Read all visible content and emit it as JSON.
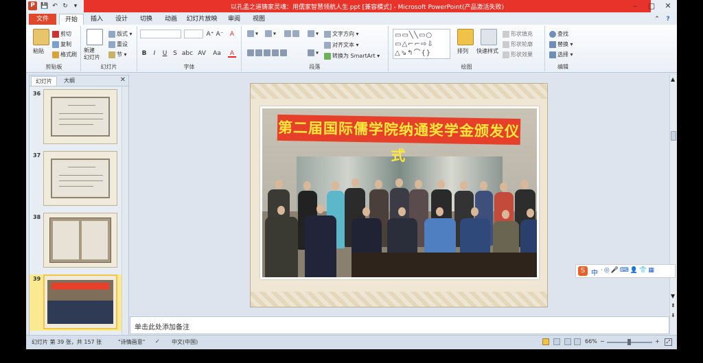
{
  "window": {
    "title": "以孔孟之道铸家灵魂：用儒家智慧领航人生.ppt [兼容模式] - Microsoft PowerPoint(产品激活失败)",
    "minimize": "–",
    "maximize": "▢",
    "close": "✕"
  },
  "quick_access": {
    "save": "💾",
    "undo": "↶",
    "redo": "↻",
    "more": "▾"
  },
  "tabs": [
    "文件",
    "开始",
    "插入",
    "设计",
    "切换",
    "动画",
    "幻灯片放映",
    "审阅",
    "视图"
  ],
  "ribbon": {
    "clipboard": {
      "label": "剪贴板",
      "paste": "粘贴",
      "cut": "剪切",
      "copy": "复制",
      "format_painter": "格式刷"
    },
    "slides": {
      "label": "幻灯片",
      "new_slide": "新建\n幻灯片",
      "layout": "版式",
      "reset": "重设",
      "section": "节"
    },
    "font": {
      "label": "字体",
      "grow": "A⁺",
      "shrink": "A⁻",
      "clear": "A",
      "bold": "B",
      "italic": "I",
      "underline": "U",
      "strike": "S",
      "shadow": "abc",
      "spacing": "AV",
      "case": "Aa",
      "color": "A"
    },
    "paragraph": {
      "label": "段落",
      "text_direction": "文字方向",
      "align_text": "对齐文本",
      "smartart": "转换为 SmartArt"
    },
    "drawing": {
      "label": "绘图",
      "arrange": "排列",
      "quick_styles": "快速样式",
      "shape_fill": "形状填充",
      "shape_outline": "形状轮廓",
      "shape_effects": "形状效果"
    },
    "editing": {
      "label": "编辑",
      "find": "查找",
      "replace": "替换",
      "select": "选择"
    }
  },
  "panel": {
    "tab_slides": "幻灯片",
    "tab_outline": "大纲",
    "close": "✕",
    "thumbnails": [
      {
        "number": "36",
        "kind": "certificate"
      },
      {
        "number": "37",
        "kind": "certificate"
      },
      {
        "number": "38",
        "kind": "book"
      },
      {
        "number": "39",
        "kind": "photo",
        "selected": true
      }
    ]
  },
  "slide": {
    "banner_text": "第二届国际儒学院纳通奖学金颁发仪式"
  },
  "notes": {
    "placeholder": "单击此处添加备注"
  },
  "statusbar": {
    "slide_info": "幻灯片 第 39 张，共 157 张",
    "theme": "\"诗情画意\"",
    "language": "中文(中国)",
    "zoom": "66%",
    "zoom_out": "−",
    "zoom_in": "+"
  },
  "ime": {
    "logo": "S",
    "mode": "中",
    "icons": "·◎🎤⌨👤👕▦"
  },
  "colors": {
    "accent": "#e8332b",
    "file_tab": "#e0482e",
    "banner_bg": "#e6402a",
    "banner_text": "#ffe83a"
  }
}
